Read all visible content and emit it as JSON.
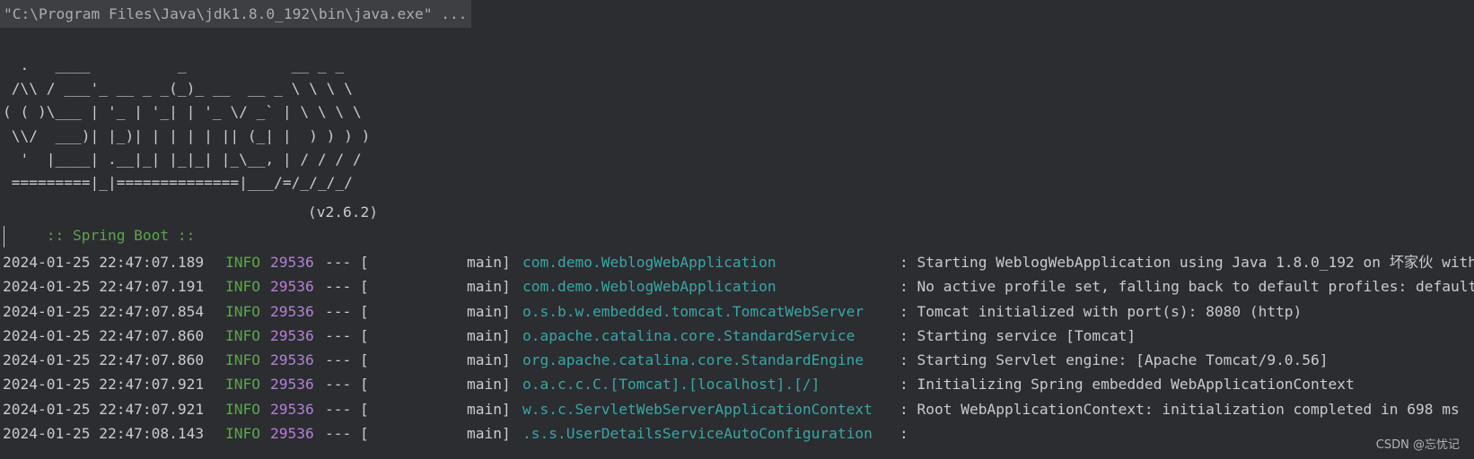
{
  "console": {
    "command_line": "\"C:\\Program Files\\Java\\jdk1.8.0_192\\bin\\java.exe\" ...",
    "banner_ascii": "  .   ____          _            __ _ _\n /\\\\ / ___'_ __ _ _(_)_ __  __ _ \\ \\ \\ \\\n( ( )\\___ | '_ | '_| | '_ \\/ _` | \\ \\ \\ \\\n \\\\/  ___)| |_)| | | | | || (_| |  ) ) ) )\n  '  |____| .__|_| |_|_| |_\\__, | / / / /\n =========|_|==============|___/=/_/_/_/",
    "spring_label": " :: Spring Boot :: ",
    "spring_version": "(v2.6.2)",
    "log_lines": [
      {
        "timestamp": "2024-01-25 22:47:07.189",
        "level": "INFO",
        "pid": "29536",
        "separator": "--- [",
        "thread": "main]",
        "logger": "com.demo.WeblogWebApplication",
        "message": ": Starting WeblogWebApplication using Java 1.8.0_192 on 坏家伙 with"
      },
      {
        "timestamp": "2024-01-25 22:47:07.191",
        "level": "INFO",
        "pid": "29536",
        "separator": "--- [",
        "thread": "main]",
        "logger": "com.demo.WeblogWebApplication",
        "message": ": No active profile set, falling back to default profiles: default"
      },
      {
        "timestamp": "2024-01-25 22:47:07.854",
        "level": "INFO",
        "pid": "29536",
        "separator": "--- [",
        "thread": "main]",
        "logger": "o.s.b.w.embedded.tomcat.TomcatWebServer",
        "message": ": Tomcat initialized with port(s): 8080 (http)"
      },
      {
        "timestamp": "2024-01-25 22:47:07.860",
        "level": "INFO",
        "pid": "29536",
        "separator": "--- [",
        "thread": "main]",
        "logger": "o.apache.catalina.core.StandardService",
        "message": ": Starting service [Tomcat]"
      },
      {
        "timestamp": "2024-01-25 22:47:07.860",
        "level": "INFO",
        "pid": "29536",
        "separator": "--- [",
        "thread": "main]",
        "logger": "org.apache.catalina.core.StandardEngine",
        "message": ": Starting Servlet engine: [Apache Tomcat/9.0.56]"
      },
      {
        "timestamp": "2024-01-25 22:47:07.921",
        "level": "INFO",
        "pid": "29536",
        "separator": "--- [",
        "thread": "main]",
        "logger": "o.a.c.c.C.[Tomcat].[localhost].[/]",
        "message": ": Initializing Spring embedded WebApplicationContext"
      },
      {
        "timestamp": "2024-01-25 22:47:07.921",
        "level": "INFO",
        "pid": "29536",
        "separator": "--- [",
        "thread": "main]",
        "logger": "w.s.c.ServletWebServerApplicationContext",
        "message": ": Root WebApplicationContext: initialization completed in 698 ms"
      },
      {
        "timestamp": "2024-01-25 22:47:08.143",
        "level": "INFO",
        "pid": "29536",
        "separator": "--- [",
        "thread": "main]",
        "logger": ".s.s.UserDetailsServiceAutoConfiguration",
        "message": ":"
      }
    ]
  },
  "watermark": "CSDN @忘忧记",
  "colors": {
    "background": "#2b2d30",
    "text": "#c8cbd0",
    "info_level": "#5fa34f",
    "pid": "#b57fd6",
    "logger": "#3aa6a6",
    "spring_label": "#5fa34f",
    "command_bar": "#3d3f43"
  }
}
